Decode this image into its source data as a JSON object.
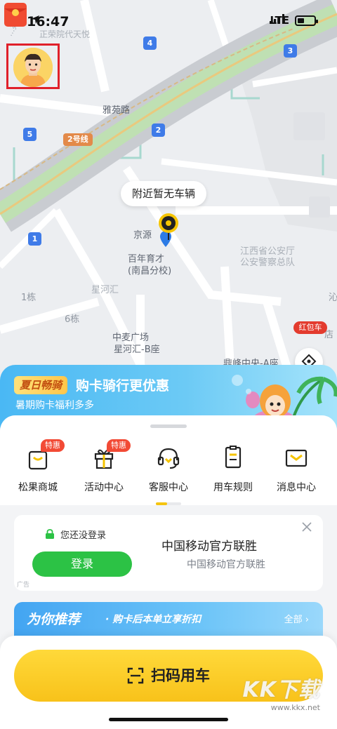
{
  "status_bar": {
    "time": "16:47",
    "network": "LTE"
  },
  "map": {
    "bubble_text": "附近暂无车辆",
    "streets": [
      {
        "key": "yayuan",
        "text": "雅苑路"
      },
      {
        "key": "line2",
        "text": "2号线"
      },
      {
        "key": "jingyuan",
        "text": "京源"
      },
      {
        "key": "school1",
        "text": "百年育才"
      },
      {
        "key": "school2",
        "text": "(南昌分校)"
      },
      {
        "key": "xinghe",
        "text": "星河汇"
      },
      {
        "key": "b1",
        "text": "1栋"
      },
      {
        "key": "b6",
        "text": "6栋"
      },
      {
        "key": "zhongmai",
        "text": "中麦广场"
      },
      {
        "key": "xinghe_b",
        "text": "星河汇-B座"
      },
      {
        "key": "dingfeng",
        "text": "鼎峰中央-A座"
      },
      {
        "key": "police1",
        "text": "江西省公安厅"
      },
      {
        "key": "police2",
        "text": "公安警察总队"
      },
      {
        "key": "road_tl",
        "text": "…苑路"
      },
      {
        "key": "top_faint",
        "text": "正荣院代天悦"
      },
      {
        "key": "right_cut1",
        "text": "沁"
      },
      {
        "key": "right_cut2",
        "text": "店"
      }
    ],
    "stops": [
      "4",
      "3",
      "2",
      "5",
      "1"
    ],
    "red_packet_label": "红包车"
  },
  "promo": {
    "tag": "夏日畅骑",
    "title": "购卡骑行更优惠",
    "subtitle": "暑期购卡福利多多"
  },
  "menu": [
    {
      "label": "松果商城",
      "tag": "特惠",
      "icon": "bag-icon"
    },
    {
      "label": "活动中心",
      "tag": "特惠",
      "icon": "gift-icon"
    },
    {
      "label": "客服中心",
      "tag": "",
      "icon": "headset-icon"
    },
    {
      "label": "用车规则",
      "tag": "",
      "icon": "document-icon"
    },
    {
      "label": "消息中心",
      "tag": "",
      "icon": "mail-icon"
    }
  ],
  "ad": {
    "login_hint": "您还没登录",
    "login_button": "登录",
    "title": "中国移动官方联胜",
    "subtitle": "中国移动官方联胜",
    "mark": "广告"
  },
  "recommend": {
    "title": "为你推荐",
    "subtitle": "· 购卡后本单立享折扣",
    "all": "全部 ›"
  },
  "scan": {
    "label": "扫码用车"
  },
  "watermark": {
    "logo": "KK下载",
    "url": "www.kkx.net"
  },
  "colors": {
    "brand_yellow": "#f8c21a",
    "login_green": "#2cc245",
    "hot_red": "#f24a35",
    "stop_blue": "#3f7be8"
  }
}
